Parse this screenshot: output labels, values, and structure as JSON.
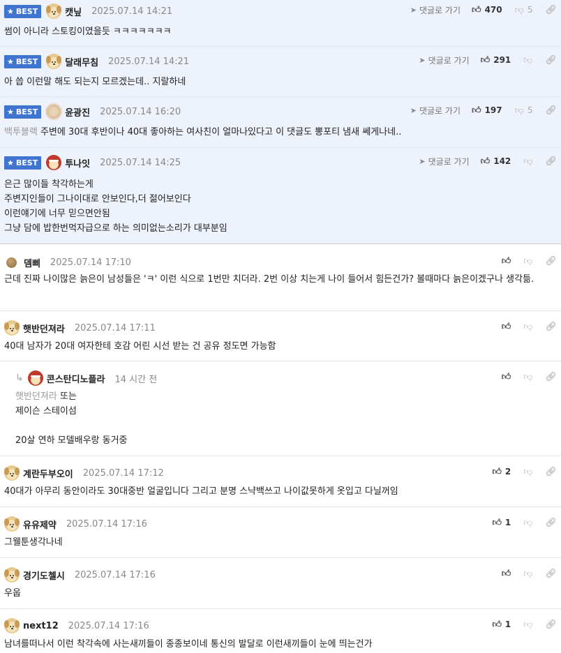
{
  "labels": {
    "best": "BEST",
    "reply_link": "댓글로 가기"
  },
  "comments": [
    {
      "nick": "캣닢",
      "date": "2025.07.14 14:21",
      "likes": "470",
      "dislikes": "5",
      "text": "썸이 아니라 스토킹이였을듯 ㅋㅋㅋㅋㅋㅋㅋ"
    },
    {
      "nick": "달래무침",
      "date": "2025.07.14 14:21",
      "likes": "291",
      "text": "아 씁 이런말 해도 되는지 모르겠는데.. 지랄하네"
    },
    {
      "nick": "윤광진",
      "date": "2025.07.14 16:20",
      "likes": "197",
      "dislikes": "5",
      "mention": "백투블랙",
      "text": " 주변에 30대 후반이나 40대 좋아하는 여사친이 얼마나있다고 이 댓글도 뽕포티 냄새 쎄게나네.."
    },
    {
      "nick": "투나잇",
      "date": "2025.07.14 14:25",
      "likes": "142",
      "text": "은근 많이들 착각하는게\n주변지인들이 그나이대로 안보인다,더 젊어보인다\n이런얘기에 너무 믿으면안됨\n그냥 담에 밥한번먹자급으로 하는 의미없는소리가 대부분임"
    },
    {
      "nick": "뎀삐",
      "date": "2025.07.14 17:10",
      "text": "근데 진짜 나이많은 늙은이 남성들은 'ㅋ' 이런 식으로 1번만 치더라. 2번 이상 치는게 나이 들어서 힘든건가? 볼때마다 늙은이겠구나 생각듦."
    },
    {
      "nick": "햇반던져라",
      "date": "2025.07.14 17:11",
      "text": "40대 남자가 20대 여자한테 호감 어린 시선 받는 건 공유 정도면 가능함"
    },
    {
      "nick": "콘스탄디노플라",
      "date": "14 시간 전",
      "mention": "햇반던져라",
      "text": " 또는\n제이슨 스테이섬\n\n20살 연하 모델배우랑 동거중"
    },
    {
      "nick": "계란두부오이",
      "date": "2025.07.14 17:12",
      "likes": "2",
      "text": "40대가 아무리 동안이라도 30대중반 얼굴입니다 그리고 분명 스냑백쓰고 나이값못하게 옷입고 다닐꺼임"
    },
    {
      "nick": "유유제약",
      "date": "2025.07.14 17:16",
      "likes": "1",
      "text": "그웰툰생각나네"
    },
    {
      "nick": "경기도첼시",
      "date": "2025.07.14 17:16",
      "text": "우웁"
    },
    {
      "nick": "next12",
      "date": "2025.07.14 17:16",
      "likes": "1",
      "text": "남녀를떠나서 이런 착각속에 사는새끼들이 종종보이네 통신의 발달로 이런새끼들이 눈에 띄는건가"
    }
  ]
}
